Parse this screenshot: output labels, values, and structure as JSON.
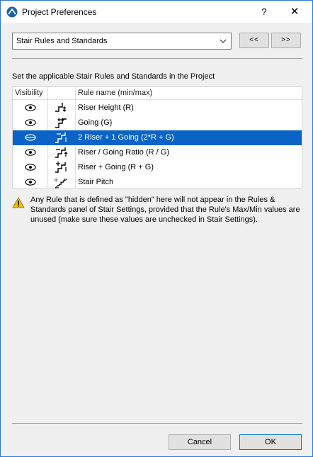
{
  "window": {
    "title": "Project Preferences",
    "help": "?",
    "close": "✕"
  },
  "header": {
    "selected_page": "Stair Rules and Standards",
    "prev_label": "<<",
    "next_label": ">>"
  },
  "description": "Set the applicable Stair Rules and Standards in the Project",
  "table": {
    "col_visibility": "Visibility",
    "col_name": "Rule name (min/max)",
    "rows": [
      {
        "name": "Riser Height (R)",
        "icon": "riser-height-icon",
        "visible": true,
        "selected": false
      },
      {
        "name": "Going (G)",
        "icon": "going-icon",
        "visible": true,
        "selected": false
      },
      {
        "name": "2 Riser + 1 Going (2*R + G)",
        "icon": "two-riser-one-going-icon",
        "visible": false,
        "selected": true
      },
      {
        "name": "Riser / Going Ratio (R / G)",
        "icon": "riser-going-ratio-icon",
        "visible": true,
        "selected": false
      },
      {
        "name": "Riser + Going (R + G)",
        "icon": "riser-plus-going-icon",
        "visible": true,
        "selected": false
      },
      {
        "name": "Stair Pitch",
        "icon": "stair-pitch-icon",
        "visible": true,
        "selected": false
      }
    ]
  },
  "warning": {
    "icon": "warning-icon",
    "text": "Any Rule that is defined as \"hidden\" here will not appear in the Rules & Standards panel of Stair Settings, provided that the Rule's Max/Min values are unused (make sure these values are unchecked in Stair Settings)."
  },
  "footer": {
    "cancel_label": "Cancel",
    "ok_label": "OK"
  },
  "colors": {
    "selection": "#0a64c8",
    "border": "#2b79d4",
    "warning": "#f2c200"
  }
}
